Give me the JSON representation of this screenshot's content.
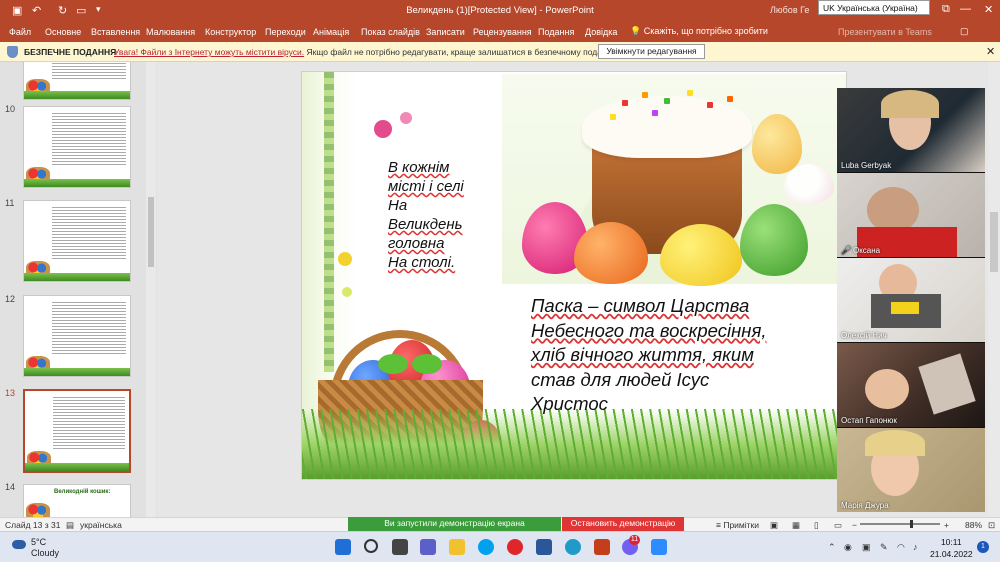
{
  "titlebar": {
    "title": "Великдень (1)[Protected View] - PowerPoint",
    "user": "Любов Ге",
    "language_popup": "UK Українська (Україна)"
  },
  "ribbon": {
    "tabs": [
      "Файл",
      "Основне",
      "Вставлення",
      "Малювання",
      "Конструктор",
      "Переходи",
      "Анімація",
      "Показ слайдів",
      "Записати",
      "Рецензування",
      "Подання",
      "Довідка"
    ],
    "tell_me": "Скажіть, що потрібно зробити",
    "teams": "Презентувати в Teams"
  },
  "message_bar": {
    "label": "БЕЗПЕЧНЕ ПОДАННЯ",
    "warning_lead": "Увага! Файли з Інтернету можуть містити віруси.",
    "warning_text": "Якщо файл не потрібно редагувати, краще залишатися в безпечному поданні.",
    "enable_button": "Увімкнути редагування"
  },
  "thumbnails": [
    {
      "number": "10",
      "active": false
    },
    {
      "number": "11",
      "active": false
    },
    {
      "number": "12",
      "active": false
    },
    {
      "number": "13",
      "active": true
    },
    {
      "number": "14",
      "active": false,
      "heading": "Великодній кошик:"
    }
  ],
  "slide": {
    "text_a": [
      "В кожнім",
      "місті і селі",
      "На",
      "Великдень",
      "головна",
      "На столі."
    ],
    "text_b": [
      "Паска – символ Царства",
      "Небесного та воскресіння,",
      "хліб вічного життя, яким",
      "став для людей Ісус",
      "Христос"
    ]
  },
  "video_participants": [
    "Luba Gerbyak",
    "Оксана",
    "Олексій Нич",
    "Остап Гапонюк",
    "Марія Джура"
  ],
  "status_bar": {
    "slide_counter": "Слайд 13 з 31",
    "language": "українська",
    "sharing_notice": "Ви запустили демонстрацію екрана",
    "stop_sharing": "Остановить демонстрацію",
    "notes": "Примітки",
    "zoom": "88%"
  },
  "taskbar": {
    "temperature": "5°C",
    "weather": "Cloudy",
    "time": "10:11",
    "date": "21.04.2022",
    "badge_count": "11",
    "notification_count": "1"
  }
}
